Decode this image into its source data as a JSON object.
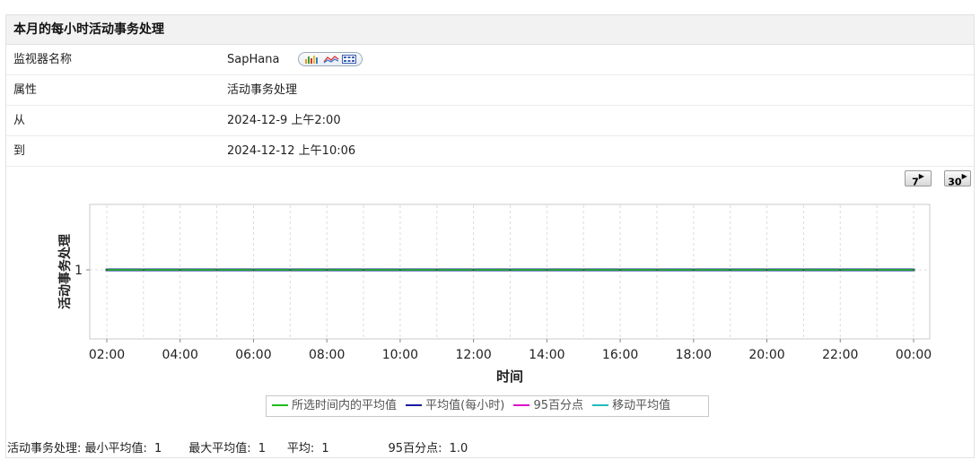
{
  "panel": {
    "title": "本月的每小时活动事务处理",
    "rows": [
      {
        "label": "监视器名称",
        "value": "SapHana"
      },
      {
        "label": "属性",
        "value": "活动事务处理"
      },
      {
        "label": "从",
        "value": "2024-12-9 上午2:00"
      },
      {
        "label": "到",
        "value": "2024-12-12 上午10:06"
      }
    ],
    "monitor_icons": [
      "bar-chart-icon",
      "line-chart-icon",
      "table-icon"
    ]
  },
  "range_buttons": [
    {
      "label": "7",
      "days": 7
    },
    {
      "label": "30",
      "days": 30
    }
  ],
  "chart_data": {
    "type": "line",
    "xlabel": "时间",
    "ylabel": "活动事务处理",
    "x_ticks": [
      "02:00",
      "04:00",
      "06:00",
      "08:00",
      "10:00",
      "12:00",
      "14:00",
      "16:00",
      "18:00",
      "20:00",
      "22:00",
      "00:00"
    ],
    "y_ticks": [
      "1"
    ],
    "x": [
      "02:00",
      "03:00",
      "04:00",
      "05:00",
      "06:00",
      "07:00",
      "08:00",
      "09:00",
      "10:00",
      "11:00",
      "12:00",
      "13:00",
      "14:00",
      "15:00",
      "16:00",
      "17:00",
      "18:00",
      "19:00",
      "20:00",
      "21:00",
      "22:00",
      "23:00",
      "00:00"
    ],
    "series": [
      {
        "name": "所选时间内的平均值",
        "color": "#22bb22",
        "values": [
          1,
          1,
          1,
          1,
          1,
          1,
          1,
          1,
          1,
          1,
          1,
          1,
          1,
          1,
          1,
          1,
          1,
          1,
          1,
          1,
          1,
          1,
          1
        ]
      },
      {
        "name": "平均值(每小时)",
        "color": "#1a1aa0",
        "values": [
          1,
          1,
          1,
          1,
          1,
          1,
          1,
          1,
          1,
          1,
          1,
          1,
          1,
          1,
          1,
          1,
          1,
          1,
          1,
          1,
          1,
          1,
          1
        ]
      },
      {
        "name": "95百分点",
        "color": "#dd11cc",
        "values": [
          1,
          1,
          1,
          1,
          1,
          1,
          1,
          1,
          1,
          1,
          1,
          1,
          1,
          1,
          1,
          1,
          1,
          1,
          1,
          1,
          1,
          1,
          1
        ]
      },
      {
        "name": "移动平均值",
        "color": "#22bbbb",
        "values": [
          1,
          1,
          1,
          1,
          1,
          1,
          1,
          1,
          1,
          1,
          1,
          1,
          1,
          1,
          1,
          1,
          1,
          1,
          1,
          1,
          1,
          1,
          1
        ]
      }
    ],
    "grid": true,
    "legend_position": "bottom"
  },
  "summary": {
    "min_label": "活动事务处理: 最小平均值:",
    "min_value": "1",
    "max_label": "最大平均值:",
    "max_value": "1",
    "avg_label": "平均:",
    "avg_value": "1",
    "p95_label": "95百分点:",
    "p95_value": "1.0"
  }
}
